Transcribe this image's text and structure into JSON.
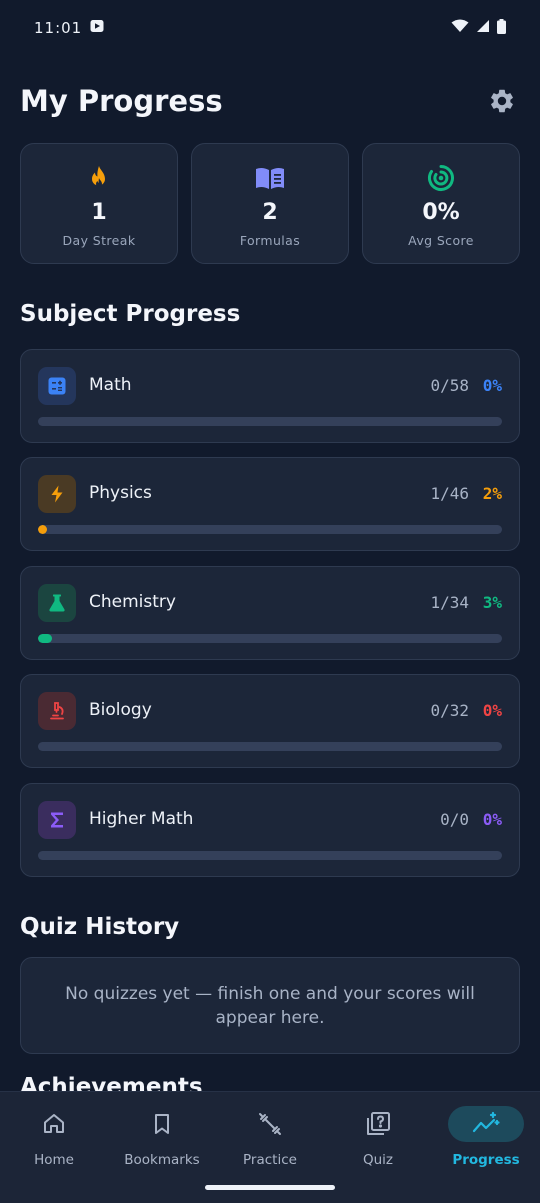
{
  "status_bar": {
    "time": "11:01"
  },
  "header": {
    "title": "My Progress"
  },
  "stats": [
    {
      "value": "1",
      "label": "Day Streak",
      "icon": "flame-icon",
      "color": "#f59e0b"
    },
    {
      "value": "2",
      "label": "Formulas",
      "icon": "book-icon",
      "color": "#818cf8"
    },
    {
      "value": "0%",
      "label": "Avg Score",
      "icon": "target-icon",
      "color": "#10b981"
    }
  ],
  "subject_section": {
    "title": "Subject Progress"
  },
  "subjects": [
    {
      "name": "Math",
      "count": "0/58",
      "percent": "0%",
      "progress": 0,
      "color": "#3b82f6",
      "icon": "calculator-icon"
    },
    {
      "name": "Physics",
      "count": "1/46",
      "percent": "2%",
      "progress": 2,
      "color": "#f59e0b",
      "icon": "lightning-icon"
    },
    {
      "name": "Chemistry",
      "count": "1/34",
      "percent": "3%",
      "progress": 3,
      "color": "#10b981",
      "icon": "flask-icon"
    },
    {
      "name": "Biology",
      "count": "0/32",
      "percent": "0%",
      "progress": 0,
      "color": "#ef4444",
      "icon": "microscope-icon"
    },
    {
      "name": "Higher Math",
      "count": "0/0",
      "percent": "0%",
      "progress": 0,
      "color": "#8b5cf6",
      "icon": "sigma-icon"
    }
  ],
  "quiz_section": {
    "title": "Quiz History",
    "empty_message": "No quizzes yet — finish one and your scores will appear here."
  },
  "achievements_section": {
    "title": "Achievements"
  },
  "bottom_nav": [
    {
      "label": "Home",
      "icon": "home-icon",
      "active": false
    },
    {
      "label": "Bookmarks",
      "icon": "bookmark-icon",
      "active": false
    },
    {
      "label": "Practice",
      "icon": "dumbbell-icon",
      "active": false
    },
    {
      "label": "Quiz",
      "icon": "quiz-icon",
      "active": false
    },
    {
      "label": "Progress",
      "icon": "trend-sparkle-icon",
      "active": true
    }
  ],
  "accent_color": "#22b8e0"
}
